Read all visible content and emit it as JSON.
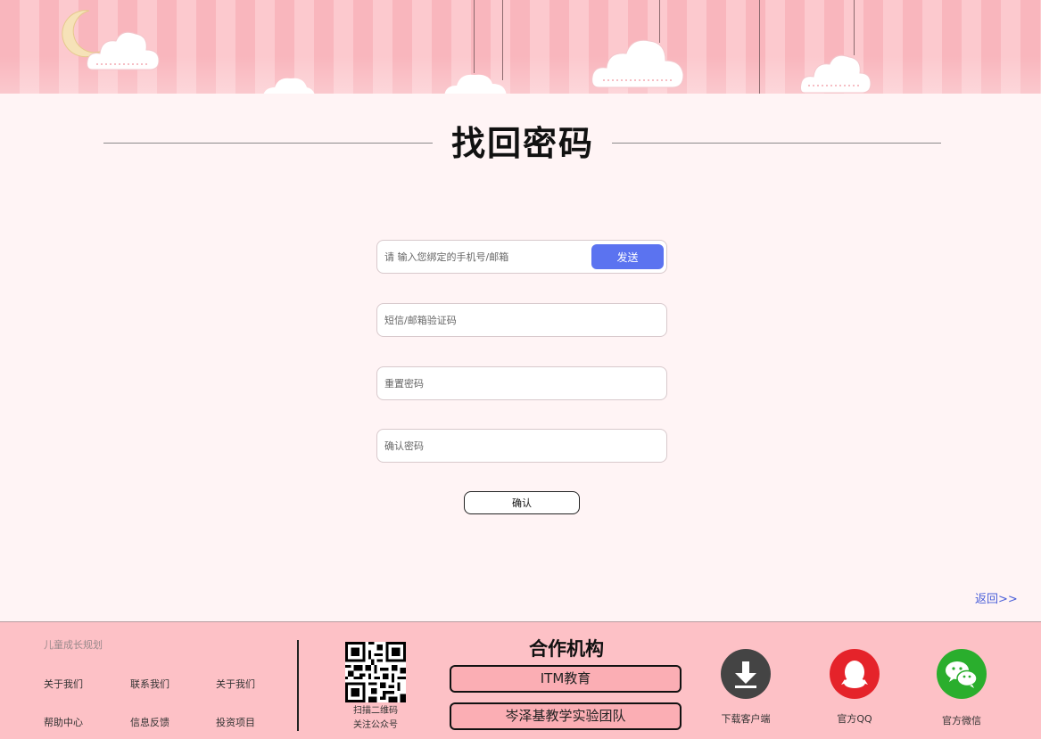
{
  "title": "找回密码",
  "form": {
    "account_placeholder": "请 输入您绑定的手机号/邮箱",
    "send_label": "发送",
    "code_placeholder": "短信/邮箱验证码",
    "new_password_placeholder": "重置密码",
    "confirm_password_placeholder": "确认密码",
    "confirm_label": "确认"
  },
  "back_link": "返回>>",
  "footer": {
    "heading": "儿童成长规划",
    "links_row1": [
      "关于我们",
      "联系我们",
      "关于我们"
    ],
    "links_row2": [
      "帮助中心",
      "信息反馈",
      "投资项目"
    ],
    "qr_caption_1": "扫描二维码",
    "qr_caption_2": "关注公众号",
    "partners_title": "合作机构",
    "partners": [
      "ITM教育",
      "岑泽基教学实验团队"
    ],
    "download_label": "下载客户端",
    "qq_label": "官方QQ",
    "wechat_label": "官方微信"
  },
  "colors": {
    "accent_blue": "#5b73f0",
    "footer_bg": "#fdc1c6",
    "qq_red": "#e5232a",
    "wechat_green": "#2aae2d",
    "download_gray": "#444444"
  },
  "icons": [
    "moon-icon",
    "cloud-icon",
    "qr-code",
    "download-icon",
    "qq-icon",
    "wechat-icon"
  ]
}
